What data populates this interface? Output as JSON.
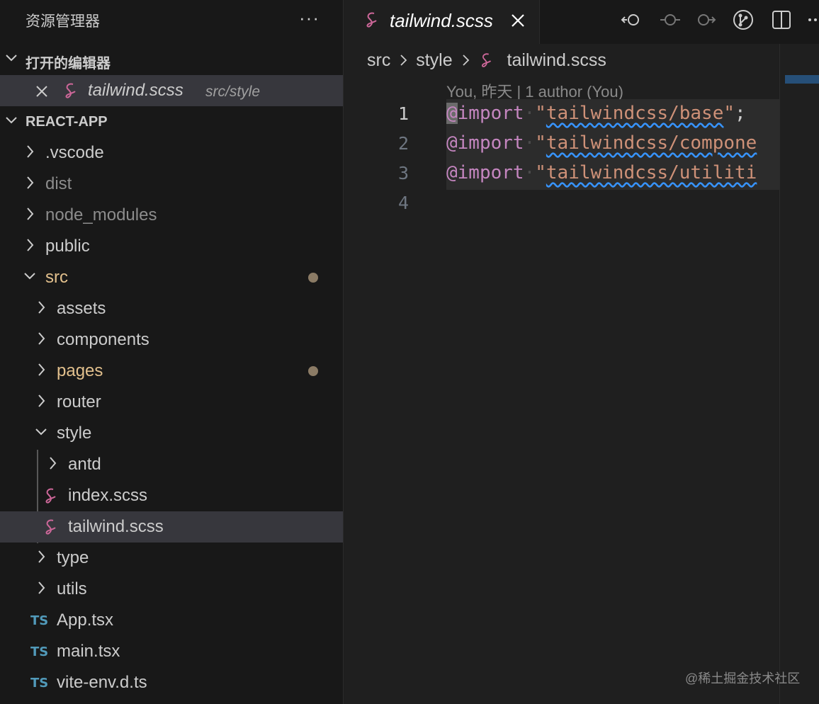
{
  "explorer": {
    "title": "资源管理器",
    "more": "···",
    "open_editors_label": "打开的编辑器",
    "open_editor": {
      "name": "tailwind.scss",
      "path": "src/style"
    },
    "project_label": "REACT-APP",
    "tree": [
      {
        "label": ".vscode",
        "kind": "folder",
        "expanded": false,
        "color": "#cccccc"
      },
      {
        "label": "dist",
        "kind": "folder",
        "expanded": false,
        "color": "#8c8c8c"
      },
      {
        "label": "node_modules",
        "kind": "folder",
        "expanded": false,
        "color": "#8c8c8c"
      },
      {
        "label": "public",
        "kind": "folder",
        "expanded": false,
        "color": "#cccccc"
      },
      {
        "label": "src",
        "kind": "folder",
        "expanded": true,
        "color": "#e2c08d",
        "modified": true
      },
      {
        "label": "assets",
        "kind": "folder",
        "expanded": false,
        "color": "#cccccc"
      },
      {
        "label": "components",
        "kind": "folder",
        "expanded": false,
        "color": "#cccccc"
      },
      {
        "label": "pages",
        "kind": "folder",
        "expanded": false,
        "color": "#e2c08d",
        "modified": true
      },
      {
        "label": "router",
        "kind": "folder",
        "expanded": false,
        "color": "#cccccc"
      },
      {
        "label": "style",
        "kind": "folder",
        "expanded": true,
        "color": "#cccccc"
      },
      {
        "label": "antd",
        "kind": "folder",
        "expanded": false,
        "color": "#cccccc"
      },
      {
        "label": "index.scss",
        "kind": "scss",
        "color": "#cccccc"
      },
      {
        "label": "tailwind.scss",
        "kind": "scss",
        "color": "#cccccc",
        "selected": true
      },
      {
        "label": "type",
        "kind": "folder",
        "expanded": false,
        "color": "#cccccc"
      },
      {
        "label": "utils",
        "kind": "folder",
        "expanded": false,
        "color": "#cccccc"
      },
      {
        "label": "App.tsx",
        "kind": "ts",
        "color": "#cccccc"
      },
      {
        "label": "main.tsx",
        "kind": "ts",
        "color": "#cccccc"
      },
      {
        "label": "vite-env.d.ts",
        "kind": "ts",
        "color": "#cccccc"
      }
    ]
  },
  "ts_badge": "TS",
  "editor": {
    "tab_label": "tailwind.scss",
    "breadcrumb": [
      "src",
      "style",
      "tailwind.scss"
    ],
    "blame": "You, 昨天 | 1 author (You)",
    "lines": [
      {
        "num": "1",
        "at": "@",
        "kw": "import",
        "quote_open": "\"",
        "str": "tailwindcss/base",
        "quote_close": "\"",
        "punc": ";"
      },
      {
        "num": "2",
        "at": "@",
        "kw": "import",
        "quote_open": "\"",
        "str": "tailwindcss/compone",
        "quote_close": "",
        "punc": ""
      },
      {
        "num": "3",
        "at": "@",
        "kw": "import",
        "quote_open": "\"",
        "str": "tailwindcss/utiliti",
        "quote_close": "",
        "punc": ""
      },
      {
        "num": "4",
        "at": "",
        "kw": "",
        "quote_open": "",
        "str": "",
        "quote_close": "",
        "punc": ""
      }
    ],
    "whitespace_dot": "·"
  },
  "watermark": "@稀土掘金技术社区",
  "colors": {
    "accent_blue": "#3794ff",
    "keyword": "#c586c0",
    "string": "#ce9178",
    "scss_icon": "#cd6799",
    "ts_icon": "#519aba",
    "modified": "#e2c08d"
  },
  "icons": {
    "tab_actions": [
      "go-back-icon",
      "timeline-icon",
      "go-forward-icon",
      "source-control-icon",
      "split-editor-icon",
      "more-actions-icon"
    ]
  }
}
